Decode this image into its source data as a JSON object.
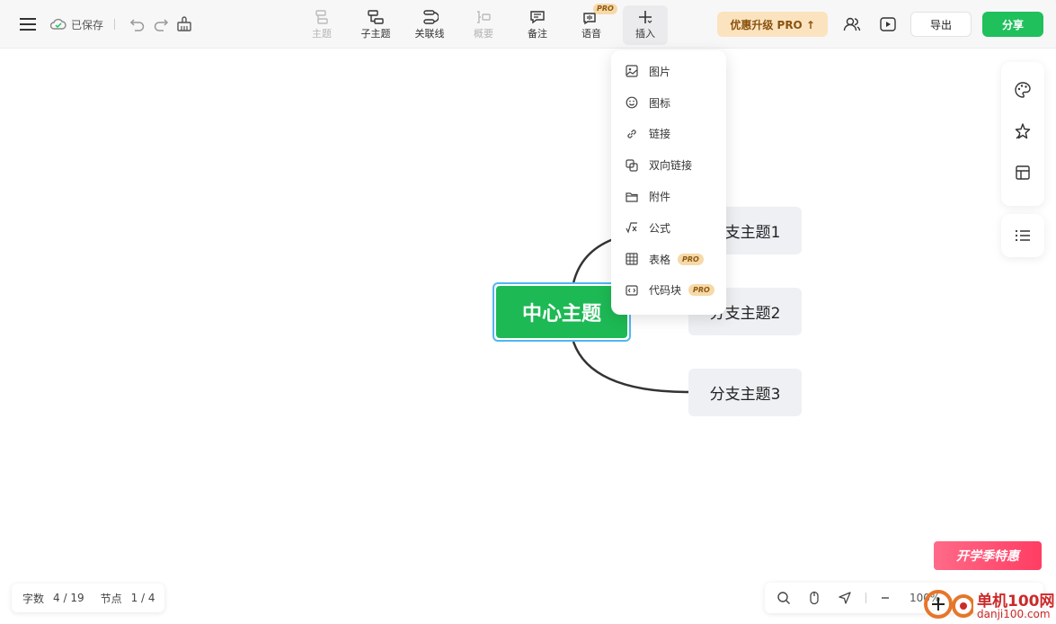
{
  "header": {
    "saved_label": "已保存",
    "tools": [
      {
        "label": "主题",
        "icon": "topic-icon",
        "disabled": true
      },
      {
        "label": "子主题",
        "icon": "subtopic-icon",
        "disabled": false
      },
      {
        "label": "关联线",
        "icon": "relation-line-icon",
        "disabled": false
      },
      {
        "label": "概要",
        "icon": "summary-icon",
        "disabled": true
      },
      {
        "label": "备注",
        "icon": "note-icon",
        "disabled": false
      },
      {
        "label": "语音",
        "icon": "voice-icon",
        "disabled": false,
        "badge": "PRO"
      },
      {
        "label": "插入",
        "icon": "plus-icon",
        "disabled": false,
        "active": true
      }
    ],
    "upgrade_label": "优惠升级 PRO ↑",
    "export_label": "导出",
    "share_label": "分享"
  },
  "insert_menu": {
    "items": [
      {
        "label": "图片",
        "icon": "image-icon"
      },
      {
        "label": "图标",
        "icon": "smiley-icon"
      },
      {
        "label": "链接",
        "icon": "link-icon"
      },
      {
        "label": "双向链接",
        "icon": "bidirectional-link-icon"
      },
      {
        "label": "附件",
        "icon": "folder-icon"
      },
      {
        "label": "公式",
        "icon": "formula-icon"
      },
      {
        "label": "表格",
        "icon": "table-icon",
        "badge": "PRO"
      },
      {
        "label": "代码块",
        "icon": "code-block-icon",
        "badge": "PRO"
      }
    ]
  },
  "mindmap": {
    "center": "中心主题",
    "branches": [
      "分支主题1",
      "分支主题2",
      "分支主题3"
    ],
    "connector_color": "#333333",
    "center_color": "#1db954",
    "selection_color": "#4fb8ef"
  },
  "stats": {
    "words_label": "字数",
    "words_value": "4 / 19",
    "nodes_label": "节点",
    "nodes_value": "1 / 4"
  },
  "zoom": {
    "level": "100%"
  },
  "promo": {
    "label": "开学季特惠"
  },
  "watermark": {
    "title": "单机100网",
    "url": "danji100.com"
  },
  "colors": {
    "accent_green": "#20c05c",
    "pro_badge": "#f7d9a8",
    "upgrade_bg": "#fbe3bf"
  }
}
